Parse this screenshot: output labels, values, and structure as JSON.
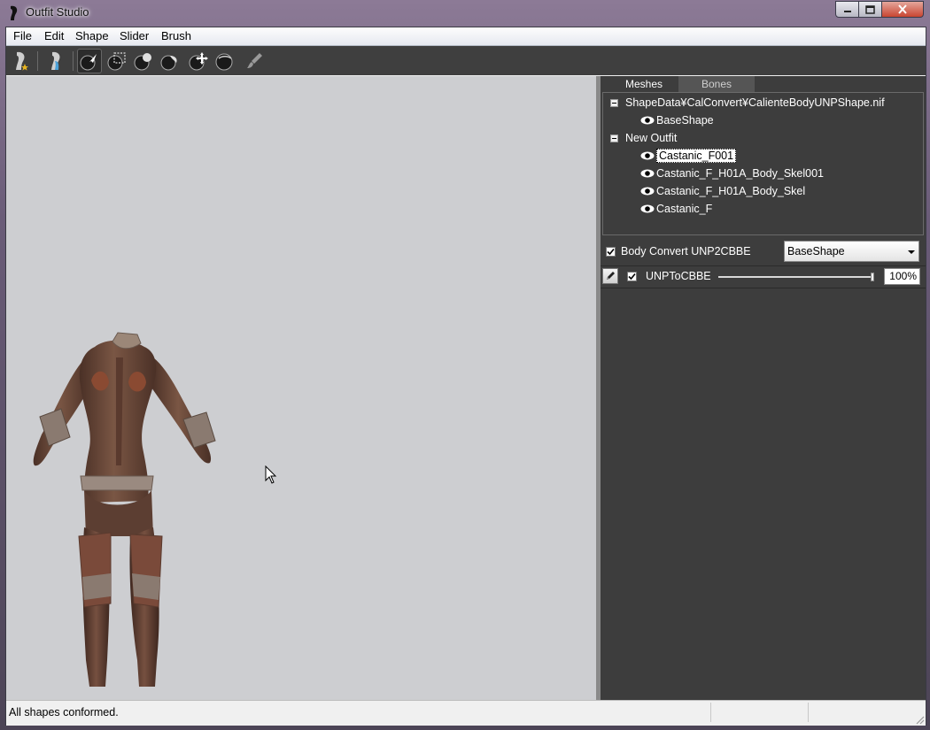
{
  "window": {
    "title": "Outfit Studio",
    "controls": [
      "minimize",
      "maximize",
      "close"
    ]
  },
  "menu": [
    "File",
    "Edit",
    "Shape",
    "Slider",
    "Brush"
  ],
  "toolbar": {
    "icons": [
      "reference-body-icon",
      "outfit-shape-icon",
      "select-brush-icon",
      "mask-brush-icon",
      "inflate-brush-icon",
      "deflate-brush-icon",
      "move-brush-icon",
      "smooth-brush-icon",
      "weight-paint-icon"
    ],
    "active": "select-brush-icon"
  },
  "panel": {
    "tabs": [
      "Meshes",
      "Bones"
    ],
    "active_tab": "Meshes",
    "tree": {
      "reference_group": "ShapeData¥CalConvert¥CalienteBodyUNPShape.nif",
      "reference_children": [
        "BaseShape"
      ],
      "outfit_group": "New Outfit",
      "outfit_children": [
        "Castanic_F001",
        "Castanic_F_H01A_Body_Skel001",
        "Castanic_F_H01A_Body_Skel",
        "Castanic_F"
      ],
      "selected": "Castanic_F001"
    },
    "slider_set": {
      "checked": true,
      "label": "Body Convert UNP2CBBE",
      "dropdown_value": "BaseShape"
    },
    "sliders": [
      {
        "name": "UNPToCBBE",
        "checked": true,
        "value": 100,
        "value_label": "100%"
      }
    ]
  },
  "status": {
    "text": "All shapes conformed."
  },
  "colors": {
    "viewport_bg": "#cdced1",
    "panel_bg": "#3d3d3d",
    "toolbar_bg": "#3f3f3f",
    "model_skin": "#6b4a3a",
    "model_trim": "#9a5a40"
  }
}
